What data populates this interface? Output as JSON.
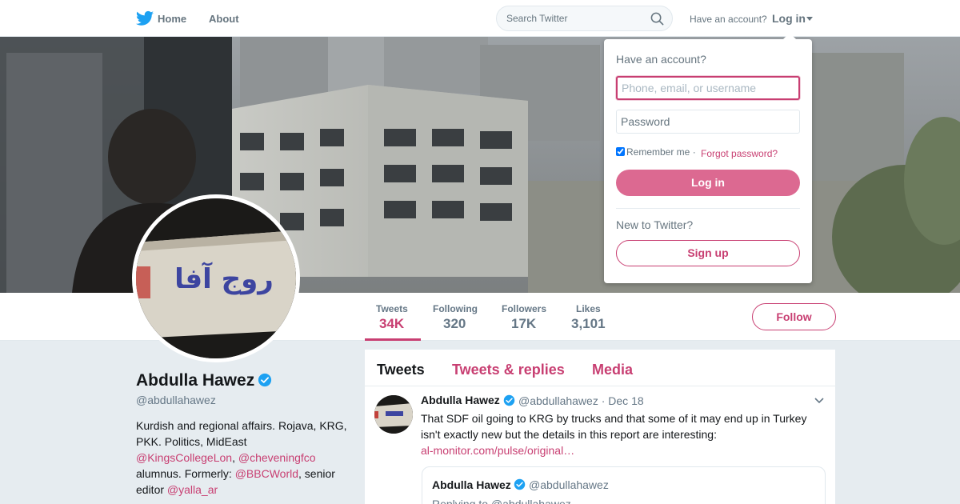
{
  "topnav": {
    "home_label": "Home",
    "about_label": "About",
    "search_placeholder": "Search Twitter",
    "have_account": "Have an account?",
    "login_label": "Log in"
  },
  "login_dropdown": {
    "title": "Have an account?",
    "username_placeholder": "Phone, email, or username",
    "password_placeholder": "Password",
    "remember_me": "Remember me",
    "separator": "·",
    "forgot_password": "Forgot password?",
    "login_button": "Log in",
    "new_to_twitter": "New to Twitter?",
    "signup_button": "Sign up"
  },
  "stats": [
    {
      "label": "Tweets",
      "value": "34K",
      "active": true
    },
    {
      "label": "Following",
      "value": "320"
    },
    {
      "label": "Followers",
      "value": "17K"
    },
    {
      "label": "Likes",
      "value": "3,101"
    }
  ],
  "follow_button": "Follow",
  "profile": {
    "name": "Abdulla Hawez",
    "handle": "@abdullahawez",
    "bio_text_1": "Kurdish and regional affairs. Rojava, KRG, PKK. Politics, MidEast ",
    "bio_link_1": "@KingsCollegeLon",
    "bio_text_2": ", ",
    "bio_link_2": "@cheveningfco",
    "bio_text_3": " alumnus. Formerly: ",
    "bio_link_3": "@BBCWorld",
    "bio_text_4": ", senior editor ",
    "bio_link_4": "@yalla_ar",
    "avatar_wall_text": "روج آفا"
  },
  "timeline": {
    "tabs": [
      "Tweets",
      "Tweets & replies",
      "Media"
    ],
    "tweet": {
      "name": "Abdulla Hawez",
      "handle": "@abdullahawez",
      "date": "· Dec 18",
      "text": "That SDF oil going to KRG by trucks and that some of it may end up in Turkey isn't exactly new but the details in this report are interesting:",
      "link": "al-monitor.com/pulse/original…",
      "quote": {
        "name": "Abdulla Hawez",
        "handle": "@abdullahawez",
        "replying": "Replying to @abdullahawez"
      }
    }
  },
  "colors": {
    "accent": "#c83f72",
    "login_button_bg": "#dc6991",
    "verified": "#1da1f2",
    "twitter_blue": "#1da1f2",
    "page_bg": "#e6ecf0"
  },
  "icons": [
    "twitter-bird-icon",
    "search-icon",
    "caret-down-icon",
    "verified-icon",
    "chevron-down-icon"
  ]
}
